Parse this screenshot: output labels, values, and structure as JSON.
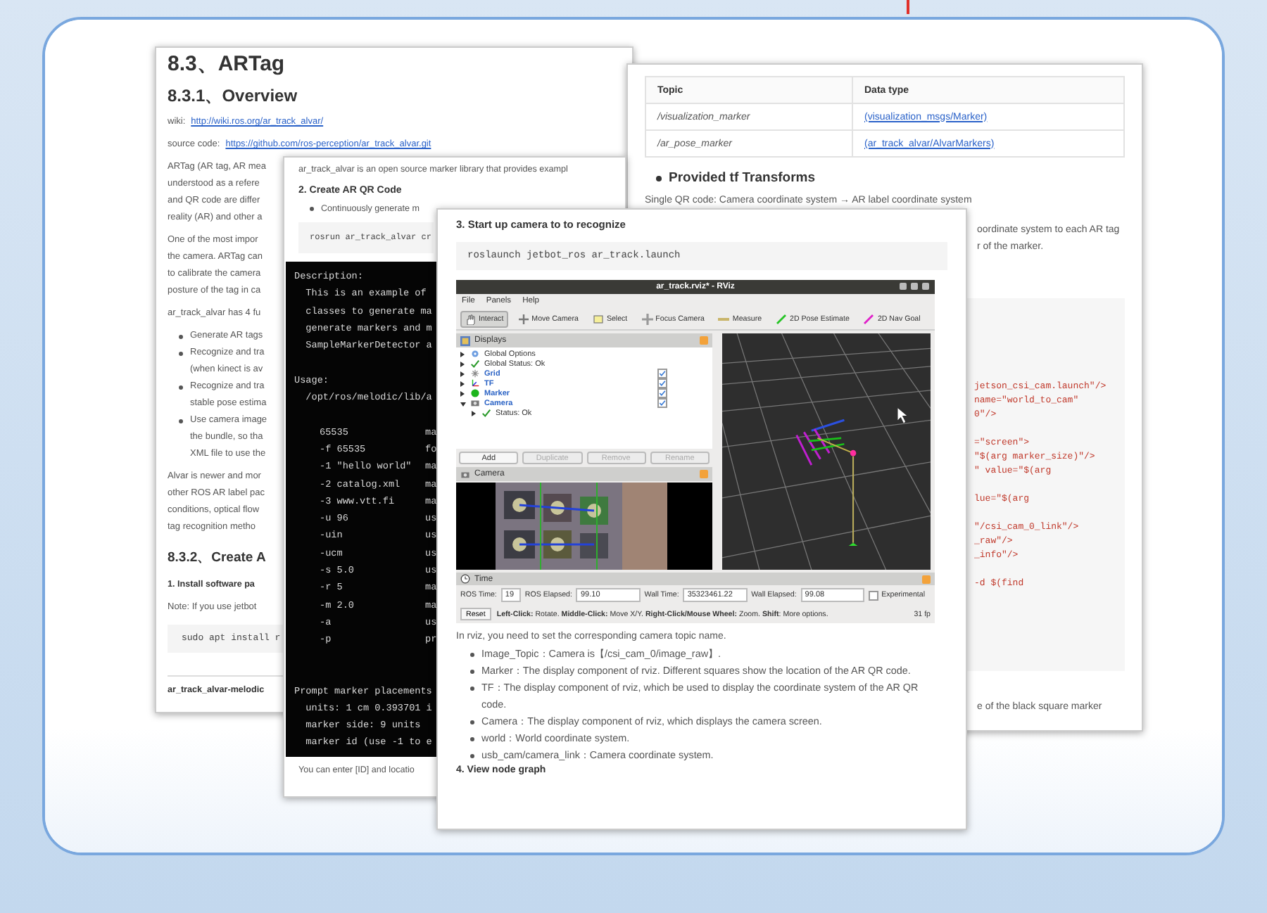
{
  "overview_page": {
    "title": "8.3、ARTag",
    "subtitle": "8.3.1、Overview",
    "wiki": {
      "label": "wiki:",
      "link": "http://wiki.ros.org/ar_track_alvar/"
    },
    "source": {
      "label": "source code:",
      "link": "https://github.com/ros-perception/ar_track_alvar.git"
    },
    "intro_lines": [
      "ARTag (AR tag, AR mea",
      "understood as a refere",
      "and QR code are differ",
      "reality (AR) and other a"
    ],
    "importance_lines": [
      "One of the most impor",
      "the camera. ARTag can",
      "to calibrate the camera",
      "posture of the tag in ca"
    ],
    "functions_line": "ar_track_alvar has 4 fu",
    "bullets": [
      [
        "Generate AR tags"
      ],
      [
        "Recognize and tra",
        "(when kinect is av"
      ],
      [
        "Recognize and tra",
        "stable pose estima"
      ],
      [
        "Use camera image",
        "the bundle, so tha",
        "XML file to use the"
      ]
    ],
    "alvar_lines": [
      "Alvar is newer and mor",
      "other ROS AR label pac",
      "conditions, optical flow",
      "tag recognition metho"
    ],
    "section_heading": "8.3.2、Create A",
    "step": "1. Install software pa",
    "note": "Note: If you use jetbot",
    "code": "sudo apt install r",
    "footer": "ar_track_alvar-melodic"
  },
  "topics_page": {
    "table": {
      "columns": [
        "Topic",
        "Data type"
      ],
      "rows": [
        [
          "/visualization_marker",
          "(visualization_msgs/Marker)"
        ],
        [
          "/ar_pose_marker",
          "(ar_track_alvar/AlvarMarkers)"
        ]
      ]
    },
    "tf_heading": "Provided tf Transforms",
    "single_qr": "Single QR code: Camera coordinate system → AR label coordinate system",
    "side_lines": [
      "oordinate system to each AR tag",
      "r of the marker."
    ],
    "code_blocks": [
      [
        "jetson_csi_cam.launch\"/>",
        "name=\"world_to_cam\"",
        "0\"/>"
      ],
      [
        "=\"screen\">",
        "\"$(arg marker_size)\"/>",
        "\" value=\"$(arg"
      ],
      [
        "lue=\"$(arg"
      ],
      [
        "\"/csi_cam_0_link\"/>",
        "_raw\"/>",
        "_info\"/>"
      ],
      [
        "-d $(find"
      ]
    ],
    "bottom_line": "e of the black square marker"
  },
  "terminal_page": {
    "intro": "ar_track_alvar is an open source marker library that provides exampl",
    "step": "2. Create AR QR Code",
    "bullet": "Continuously generate m",
    "command": "rosrun ar_track_alvar cr",
    "description": [
      "Description:",
      "  This is an example of",
      "  classes to generate ma",
      "  generate markers and m",
      "  SampleMarkerDetector a"
    ],
    "usage": [
      "Usage:",
      "  /opt/ros/melodic/lib/a"
    ],
    "options": [
      {
        "flag": "65535",
        "desc": "ma"
      },
      {
        "flag": "-f 65535",
        "desc": "fo"
      },
      {
        "flag": "-1 \"hello world\"",
        "desc": "ma"
      },
      {
        "flag": "-2 catalog.xml",
        "desc": "ma"
      },
      {
        "flag": "-3 www.vtt.fi",
        "desc": "ma"
      },
      {
        "flag": "-u 96",
        "desc": "us"
      },
      {
        "flag": "-uin",
        "desc": "us"
      },
      {
        "flag": "-ucm",
        "desc": "us"
      },
      {
        "flag": "-s 5.0",
        "desc": "us"
      },
      {
        "flag": "-r 5",
        "desc": "ma"
      },
      {
        "flag": "-m 2.0",
        "desc": "ma"
      },
      {
        "flag": "-a",
        "desc": "us"
      },
      {
        "flag": "-p",
        "desc": "pr"
      }
    ],
    "prompt": [
      "Prompt marker placements",
      "  units: 1 cm 0.393701 i",
      "  marker side: 9 units",
      "  marker id (use -1 to e"
    ],
    "footer_line": "You can enter [ID] and locatio"
  },
  "camera_page": {
    "step": "3. Start up camera to to recognize",
    "command": "roslaunch jetbot_ros ar_track.launch",
    "rviz": {
      "title": "ar_track.rviz* - RViz",
      "menu": [
        "File",
        "Panels",
        "Help"
      ],
      "tools": [
        {
          "label": "Interact",
          "kind": "interact",
          "selected": true
        },
        {
          "label": "Move Camera",
          "kind": "move",
          "selected": false
        },
        {
          "label": "Select",
          "kind": "select",
          "selected": false
        },
        {
          "label": "Focus Camera",
          "kind": "focus",
          "selected": false
        },
        {
          "label": "Measure",
          "kind": "measure",
          "selected": false
        },
        {
          "label": "2D Pose Estimate",
          "kind": "pose",
          "selected": false
        },
        {
          "label": "2D Nav Goal",
          "kind": "goal",
          "selected": false
        }
      ],
      "displays_title": "Displays",
      "displays": [
        {
          "label": "Global Options",
          "kind": "options",
          "expanded": false
        },
        {
          "label": "Global Status: Ok",
          "kind": "status",
          "expanded": false
        },
        {
          "label": "Grid",
          "kind": "grid",
          "expanded": false,
          "checked": true
        },
        {
          "label": "TF",
          "kind": "tf",
          "expanded": false,
          "checked": true
        },
        {
          "label": "Marker",
          "kind": "marker",
          "expanded": false,
          "checked": true
        },
        {
          "label": "Camera",
          "kind": "camera",
          "expanded": true,
          "checked": true,
          "children": [
            {
              "label": "Status: Ok",
              "kind": "status",
              "expanded": false
            }
          ]
        }
      ],
      "panel_buttons": [
        {
          "label": "Add",
          "disabled": false
        },
        {
          "label": "Duplicate",
          "disabled": true
        },
        {
          "label": "Remove",
          "disabled": true
        },
        {
          "label": "Rename",
          "disabled": true
        }
      ],
      "camera_title": "Camera",
      "time_title": "Time",
      "time_fields": [
        {
          "label": "ROS Time:",
          "value": "19"
        },
        {
          "label": "ROS Elapsed:",
          "value": "99.10"
        },
        {
          "label": "Wall Time:",
          "value": "35323461.22"
        },
        {
          "label": "Wall Elapsed:",
          "value": "99.08"
        }
      ],
      "experimental": {
        "label": "Experimental",
        "checked": false
      },
      "reset": "Reset",
      "hint": "**Left-Click:** Rotate. **Middle-Click:** Move X/Y. **Right-Click/Mouse Wheel:** Zoom. **Shift**: More options.",
      "fps": "31 fp"
    },
    "note": "In rviz, you need to set the corresponding camera topic name.",
    "bullets": [
      "Image_Topic：Camera is【/csi_cam_0/image_raw】.",
      "Marker：The display component of rviz. Different squares show the location of the AR QR code.",
      "TF：The display component of rviz, which be used to display the coordinate system of the AR QR code.",
      "Camera：The display component of rviz, which displays the camera screen.",
      "world：World coordinate system.",
      "usb_cam/camera_link：Camera coordinate system."
    ],
    "next_step": "4. View node graph"
  }
}
